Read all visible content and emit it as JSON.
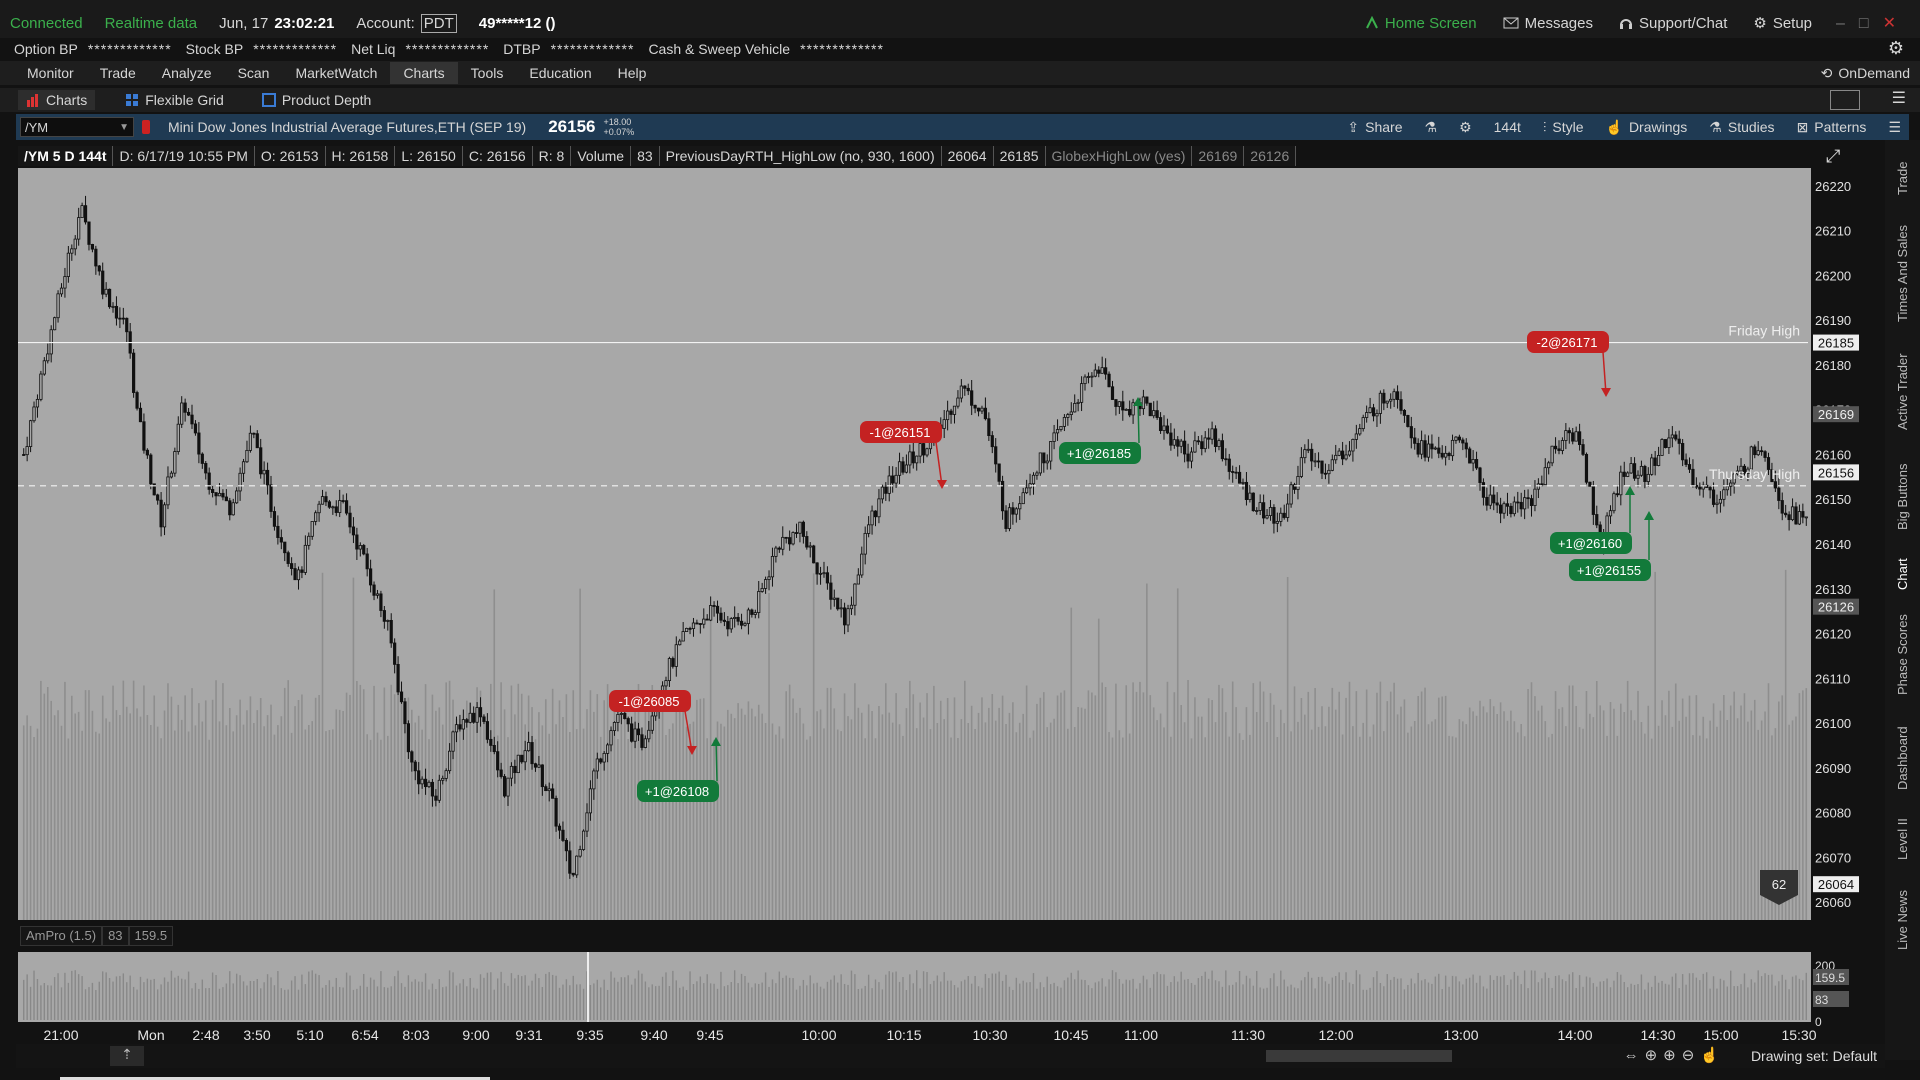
{
  "topbar": {
    "connected": "Connected",
    "realtime": "Realtime data",
    "date": "Jun, 17",
    "time": "23:02:21",
    "account_label": "Account:",
    "account_icon_text": "PDT",
    "account_value": "49*****12 ()",
    "home": "Home Screen",
    "messages": "Messages",
    "support": "Support/Chat",
    "setup": "Setup"
  },
  "bp": {
    "option_bp": "Option BP",
    "stock_bp": "Stock BP",
    "net_liq": "Net Liq",
    "dtbp": "DTBP",
    "sweep": "Cash & Sweep Vehicle",
    "masked": "*************"
  },
  "menu": [
    "Monitor",
    "Trade",
    "Analyze",
    "Scan",
    "MarketWatch",
    "Charts",
    "Tools",
    "Education",
    "Help"
  ],
  "menu_active": "Charts",
  "ondemand": "OnDemand",
  "subtabs": {
    "charts": "Charts",
    "grid": "Flexible Grid",
    "depth": "Product Depth"
  },
  "symbol": {
    "ticker": "/YM",
    "description": "Mini Dow Jones Industrial Average Futures,ETH (SEP 19)",
    "last": "26156",
    "change": "+18.00",
    "change_pct": "+0.07%",
    "share": "Share",
    "aggregation": "144t",
    "style": "Style",
    "drawings": "Drawings",
    "studies": "Studies",
    "patterns": "Patterns"
  },
  "info": {
    "sym": "/YM 5 D 144t",
    "date": "D: 6/17/19 10:55 PM",
    "open": "O: 26153",
    "high": "H: 26158",
    "low": "L: 26150",
    "close": "C: 26156",
    "range": "R: 8",
    "volume_label": "Volume",
    "volume": "83",
    "study1": "PreviousDayRTH_HighLow (no, 930, 1600)",
    "study1_v1": "26064",
    "study1_v2": "26185",
    "study2": "GlobexHighLow (yes)",
    "study2_v1": "26169",
    "study2_v2": "26126"
  },
  "chart_data": {
    "type": "candlestick",
    "y_ticks": [
      26220,
      26210,
      26200,
      26190,
      26180,
      26170,
      26160,
      26150,
      26140,
      26130,
      26120,
      26110,
      26100,
      26090,
      26080,
      26070,
      26060
    ],
    "ylim": [
      26056,
      26224
    ],
    "x_labels": [
      "21:00",
      "Mon",
      "2:48",
      "3:50",
      "5:10",
      "6:54",
      "8:03",
      "9:00",
      "9:31",
      "9:35",
      "9:40",
      "9:45",
      "10:00",
      "10:15",
      "10:30",
      "10:45",
      "11:00",
      "11:30",
      "12:00",
      "13:00",
      "14:00",
      "14:30",
      "15:00",
      "15:30"
    ],
    "price_path": [
      [
        0,
        26160
      ],
      [
        2,
        26183
      ],
      [
        4,
        26205
      ],
      [
        5,
        26215
      ],
      [
        7,
        26197
      ],
      [
        9,
        26188
      ],
      [
        10,
        26168
      ],
      [
        12,
        26145
      ],
      [
        14,
        26172
      ],
      [
        16,
        26155
      ],
      [
        18,
        26148
      ],
      [
        20,
        26165
      ],
      [
        22,
        26145
      ],
      [
        24,
        26132
      ],
      [
        26,
        26150
      ],
      [
        28,
        26148
      ],
      [
        30,
        26135
      ],
      [
        32,
        26120
      ],
      [
        34,
        26090
      ],
      [
        36,
        26083
      ],
      [
        38,
        26100
      ],
      [
        40,
        26103
      ],
      [
        42,
        26085
      ],
      [
        44,
        26095
      ],
      [
        46,
        26084
      ],
      [
        48,
        26065
      ],
      [
        50,
        26090
      ],
      [
        52,
        26102
      ],
      [
        54,
        26095
      ],
      [
        56,
        26110
      ],
      [
        58,
        26120
      ],
      [
        60,
        26125
      ],
      [
        62,
        26122
      ],
      [
        64,
        26125
      ],
      [
        66,
        26140
      ],
      [
        68,
        26143
      ],
      [
        70,
        26132
      ],
      [
        72,
        26123
      ],
      [
        74,
        26145
      ],
      [
        76,
        26155
      ],
      [
        78,
        26160
      ],
      [
        80,
        26165
      ],
      [
        82,
        26175
      ],
      [
        84,
        26170
      ],
      [
        86,
        26145
      ],
      [
        88,
        26155
      ],
      [
        90,
        26162
      ],
      [
        92,
        26172
      ],
      [
        94,
        26180
      ],
      [
        96,
        26170
      ],
      [
        98,
        26172
      ],
      [
        100,
        26165
      ],
      [
        102,
        26160
      ],
      [
        104,
        26165
      ],
      [
        106,
        26155
      ],
      [
        108,
        26148
      ],
      [
        110,
        26145
      ],
      [
        112,
        26160
      ],
      [
        114,
        26157
      ],
      [
        116,
        26162
      ],
      [
        118,
        26170
      ],
      [
        120,
        26175
      ],
      [
        122,
        26162
      ],
      [
        124,
        26160
      ],
      [
        126,
        26163
      ],
      [
        128,
        26150
      ],
      [
        130,
        26148
      ],
      [
        132,
        26150
      ],
      [
        134,
        26162
      ],
      [
        136,
        26165
      ],
      [
        138,
        26140
      ],
      [
        140,
        26157
      ],
      [
        142,
        26155
      ],
      [
        144,
        26165
      ],
      [
        146,
        26155
      ],
      [
        148,
        26150
      ],
      [
        150,
        26155
      ],
      [
        152,
        26163
      ],
      [
        154,
        26148
      ],
      [
        156,
        26145
      ]
    ],
    "reference_lines": [
      {
        "label": "Friday High",
        "value": 26185,
        "style": "solid"
      },
      {
        "label": "Thursday High",
        "value": 26153,
        "style": "dashed"
      }
    ],
    "price_badges": [
      "26185",
      "26169",
      "26156",
      "26126",
      "26064"
    ],
    "trades": [
      {
        "label": "-1@26085",
        "side": "sell"
      },
      {
        "label": "+1@26108",
        "side": "buy"
      },
      {
        "label": "-1@26151",
        "side": "sell"
      },
      {
        "label": "+1@26185",
        "side": "buy"
      },
      {
        "label": "-2@26171",
        "side": "sell"
      },
      {
        "label": "+1@26160",
        "side": "buy"
      },
      {
        "label": "+1@26155",
        "side": "buy"
      }
    ],
    "volume_badge": "62",
    "lower_study": {
      "name": "AmPro (1.5)",
      "v1": "83",
      "v2": "159.5",
      "ticks": [
        "200",
        "159.5",
        "83",
        "0"
      ]
    }
  },
  "right_tabs": [
    "Trade",
    "Times And Sales",
    "Active Trader",
    "Big Buttons",
    "Chart",
    "Phase Scores",
    "Dashboard",
    "Level II",
    "Live News"
  ],
  "status": {
    "drawing_set": "Drawing set: Default"
  },
  "colors": {
    "chart_bg": "#a8a8a8",
    "candle": "#111111",
    "sell": "#c42222",
    "buy": "#127a3a",
    "symbar": "#1f3a53"
  }
}
